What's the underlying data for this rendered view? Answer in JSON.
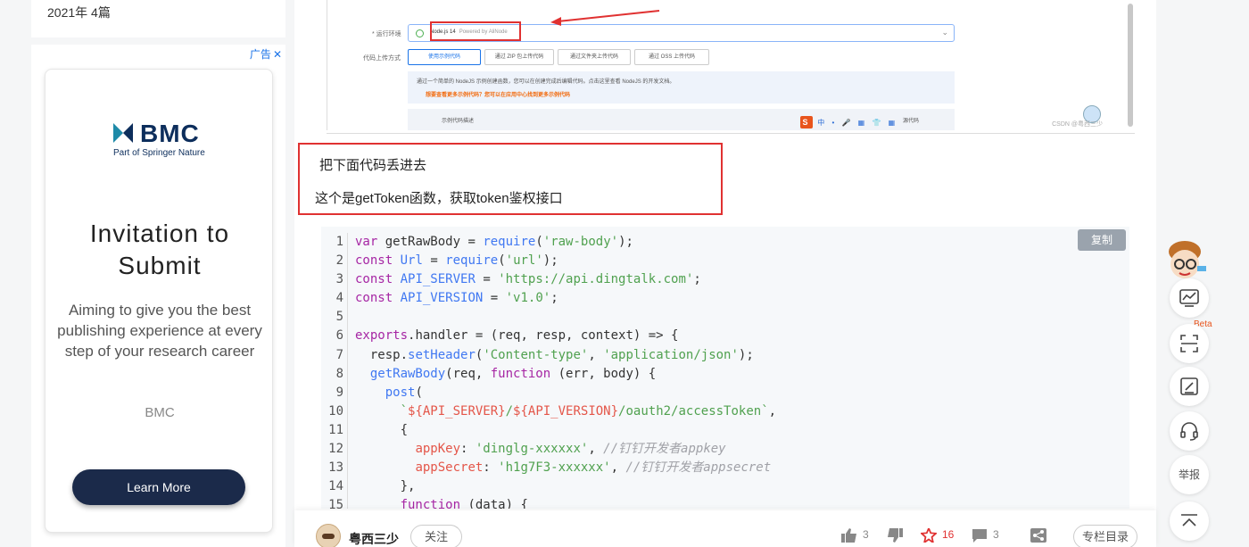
{
  "sidebar": {
    "archive_entry": "2021年  4篇",
    "ad": {
      "label": "广告",
      "close": "✕",
      "brand_logo": "BMC",
      "brand_sub": "Part of Springer Nature",
      "title": "Invitation to Submit",
      "description": "Aiming to give you the best publishing experience at every step of your research career",
      "brand_name": "BMC",
      "cta": "Learn More"
    }
  },
  "embedded_screenshot": {
    "runtime_label": "* 运行环境",
    "runtime_value": "Node.js 14",
    "runtime_powered": "Powered by AliNode",
    "upload_label": "代码上传方式",
    "upload_options": [
      "使用示例代码",
      "通过 ZIP 包上传代码",
      "通过文件夹上传代码",
      "通过 OSS 上传代码"
    ],
    "info_text": "通过一个简单的 NodeJS 示例创建函数，您可以在创建完成后编辑代码。点击这里查看 NodeJS 的开发文档。",
    "info_link": "想要查看更多示例代码？您可以在应用中心找到更多示例代码",
    "tab_left": "示例代码描述",
    "tab_right": "源代码",
    "toolbar_glyph": "S",
    "toolbar_icons": "中 • 🎤 ▦ 👕 ▦",
    "watermark": "CSDN @粤西三少"
  },
  "callout": {
    "line1": "把下面代码丢进去",
    "line2": "这个是getToken函数，获取token鉴权接口"
  },
  "code_block": {
    "copy_label": "复制",
    "line_numbers": [
      "1",
      "2",
      "3",
      "4",
      "5",
      "6",
      "7",
      "8",
      "9",
      "10",
      "11",
      "12",
      "13",
      "14",
      "15"
    ]
  },
  "author_bar": {
    "author": "粤西三少",
    "follow": "关注",
    "likes": "3",
    "stars": "16",
    "comments": "3",
    "toc": "专栏目录"
  },
  "right_rail": {
    "beta": "Beta",
    "report": "举报"
  },
  "colors": {
    "accent_red": "#e03131",
    "bmc_navy": "#0d2e5c",
    "cta_navy": "#1b2a4a",
    "link_blue": "#1a73e8"
  }
}
